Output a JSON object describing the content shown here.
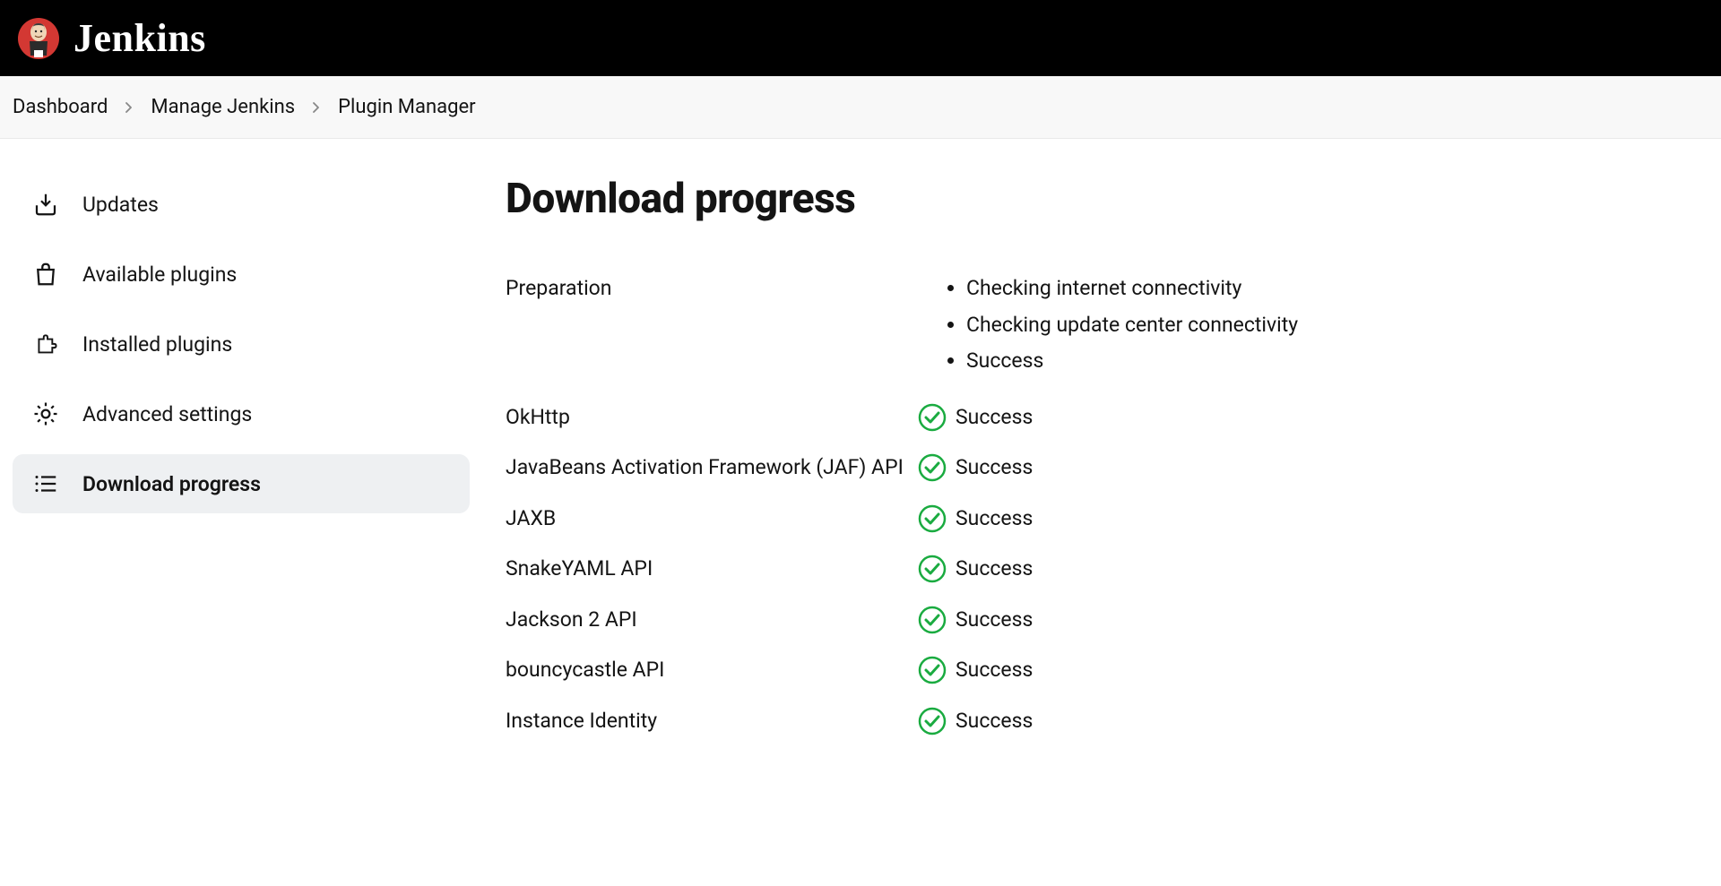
{
  "app_name": "Jenkins",
  "breadcrumb": {
    "items": [
      {
        "label": "Dashboard"
      },
      {
        "label": "Manage Jenkins"
      },
      {
        "label": "Plugin Manager"
      }
    ]
  },
  "sidebar": {
    "items": [
      {
        "label": "Updates",
        "icon": "download-icon",
        "active": false
      },
      {
        "label": "Available plugins",
        "icon": "shopping-bag-icon",
        "active": false
      },
      {
        "label": "Installed plugins",
        "icon": "puzzle-icon",
        "active": false
      },
      {
        "label": "Advanced settings",
        "icon": "gear-icon",
        "active": false
      },
      {
        "label": "Download progress",
        "icon": "list-icon",
        "active": true
      }
    ]
  },
  "main": {
    "title": "Download progress",
    "preparation": {
      "label": "Preparation",
      "steps": [
        "Checking internet connectivity",
        "Checking update center connectivity",
        "Success"
      ]
    },
    "plugins": [
      {
        "name": "OkHttp",
        "status": "Success"
      },
      {
        "name": "JavaBeans Activation Framework (JAF) API",
        "status": "Success"
      },
      {
        "name": "JAXB",
        "status": "Success"
      },
      {
        "name": "SnakeYAML API",
        "status": "Success"
      },
      {
        "name": "Jackson 2 API",
        "status": "Success"
      },
      {
        "name": "bouncycastle API",
        "status": "Success"
      },
      {
        "name": "Instance Identity",
        "status": "Success"
      }
    ]
  }
}
